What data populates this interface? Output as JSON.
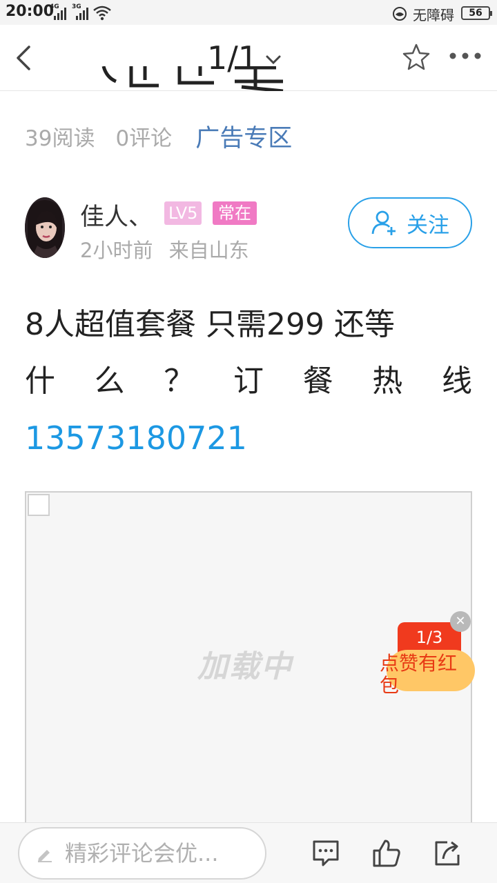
{
  "status_bar": {
    "time": "20:00",
    "network_1": "4G",
    "network_2": "3G",
    "accessibility_text": "无障碍",
    "battery": "56"
  },
  "nav": {
    "page_indicator": "1/1"
  },
  "article": {
    "reads": "39阅读",
    "comments": "0评论",
    "ad_zone": "广告专区",
    "author": {
      "name": "佳人、",
      "level_badge": "LV5",
      "status_badge": "常在",
      "time_ago": "2小时前",
      "location": "来自山东"
    },
    "follow_label": "关注",
    "body": {
      "line1": "8人超值套餐 只需299 还等",
      "line2_chars": [
        "什",
        "么",
        "？",
        "订",
        "餐",
        "热",
        "线"
      ],
      "phone": "13573180721"
    },
    "image_loading_text": "加载中"
  },
  "floating_ad": {
    "counter": "1/3",
    "text": "点赞有红包"
  },
  "bottom_bar": {
    "comment_placeholder": "精彩评论会优..."
  },
  "colors": {
    "accent_blue": "#29a0e8",
    "link_blue": "#1c98e3",
    "ad_zone_blue": "#4a7bb7",
    "badge_pink_light": "#f2b8e2",
    "badge_pink": "#f07ac4",
    "red_packet": "#f03a1e"
  }
}
